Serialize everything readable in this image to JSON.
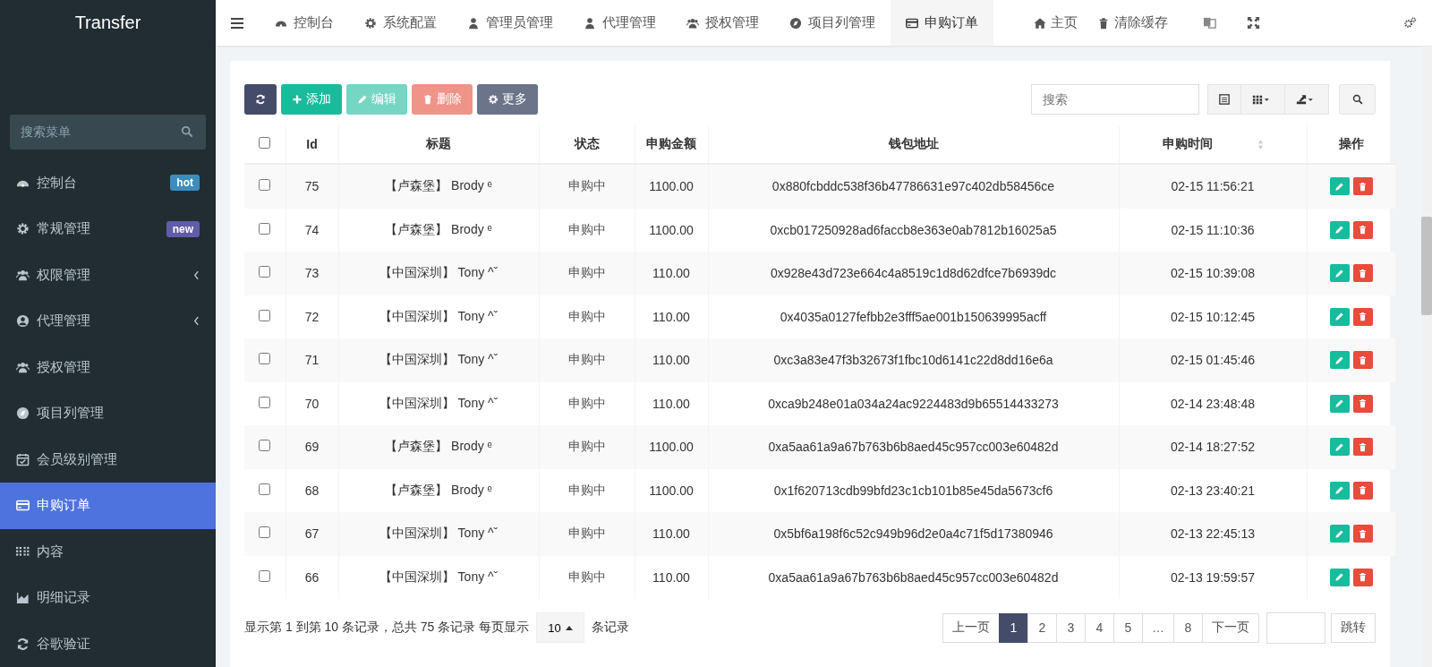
{
  "sidebar": {
    "logo": "Transfer",
    "search": {
      "placeholder": "搜索菜单"
    },
    "items": [
      {
        "label": "控制台",
        "badge": {
          "text": "hot",
          "color": "#3c8dbc"
        },
        "has_children": false,
        "selected": false
      },
      {
        "label": "常规管理",
        "badge": {
          "text": "new",
          "color": "#605ca8"
        },
        "has_children": false,
        "selected": false
      },
      {
        "label": "权限管理",
        "has_children": true,
        "selected": false
      },
      {
        "label": "代理管理",
        "has_children": true,
        "selected": false
      },
      {
        "label": "授权管理",
        "has_children": false,
        "selected": false
      },
      {
        "label": "项目列管理",
        "has_children": false,
        "selected": false
      },
      {
        "label": "会员级别管理",
        "has_children": false,
        "selected": false
      },
      {
        "label": "申购订单",
        "has_children": false,
        "selected": true
      },
      {
        "label": "内容",
        "has_children": false,
        "selected": false
      },
      {
        "label": "明细记录",
        "has_children": false,
        "selected": false
      },
      {
        "label": "谷歌验证",
        "has_children": false,
        "selected": false
      }
    ]
  },
  "tabs": [
    {
      "label": "控制台",
      "selected": false
    },
    {
      "label": "系统配置",
      "selected": false
    },
    {
      "label": "管理员管理",
      "selected": false
    },
    {
      "label": "代理管理",
      "selected": false
    },
    {
      "label": "授权管理",
      "selected": false
    },
    {
      "label": "项目列管理",
      "selected": false
    },
    {
      "label": "申购订单",
      "selected": true
    }
  ],
  "top_links": [
    "主页",
    "清除缓存"
  ],
  "toolbar": {
    "buttons": [
      {
        "kind": "refresh",
        "disabled": false
      },
      {
        "kind": "add",
        "label": "添加",
        "disabled": false
      },
      {
        "kind": "edit",
        "label": "编辑",
        "disabled": true
      },
      {
        "kind": "delete",
        "label": "删除",
        "disabled": true
      },
      {
        "kind": "more",
        "label": "更多",
        "disabled": false
      }
    ],
    "search": {
      "placeholder": "搜索"
    }
  },
  "table": {
    "select_all_checked": false,
    "columns": [
      "Id",
      "标题",
      "状态",
      "申购金额",
      "钱包地址",
      "申购时间",
      "操作"
    ],
    "rows": [
      {
        "id": "75",
        "title": "【卢森堡】 Brody ᵉ",
        "status": "申购中",
        "amount": "1100.00",
        "wallet": "0x880fcbddc538f36b47786631e97c402db58456ce",
        "time": "02-15 11:56:21",
        "checked": false
      },
      {
        "id": "74",
        "title": "【卢森堡】 Brody ᵉ",
        "status": "申购中",
        "amount": "1100.00",
        "wallet": "0xcb017250928ad6faccb8e363e0ab7812b16025a5",
        "time": "02-15 11:10:36",
        "checked": false
      },
      {
        "id": "73",
        "title": "【中国深圳】 Tony ^ˇ",
        "status": "申购中",
        "amount": "110.00",
        "wallet": "0x928e43d723e664c4a8519c1d8d62dfce7b6939dc",
        "time": "02-15 10:39:08",
        "checked": false
      },
      {
        "id": "72",
        "title": "【中国深圳】 Tony ^ˇ",
        "status": "申购中",
        "amount": "110.00",
        "wallet": "0x4035a0127fefbb2e3fff5ae001b150639995acff",
        "time": "02-15 10:12:45",
        "checked": false
      },
      {
        "id": "71",
        "title": "【中国深圳】 Tony ^ˇ",
        "status": "申购中",
        "amount": "110.00",
        "wallet": "0xc3a83e47f3b32673f1fbc10d6141c22d8dd16e6a",
        "time": "02-15 01:45:46",
        "checked": false
      },
      {
        "id": "70",
        "title": "【中国深圳】 Tony ^ˇ",
        "status": "申购中",
        "amount": "110.00",
        "wallet": "0xca9b248e01a034a24ac9224483d9b65514433273",
        "time": "02-14 23:48:48",
        "checked": false
      },
      {
        "id": "69",
        "title": "【卢森堡】 Brody ᵉ",
        "status": "申购中",
        "amount": "1100.00",
        "wallet": "0xa5aa61a9a67b763b6b8aed45c957cc003e60482d",
        "time": "02-14 18:27:52",
        "checked": false
      },
      {
        "id": "68",
        "title": "【卢森堡】 Brody ᵉ",
        "status": "申购中",
        "amount": "1100.00",
        "wallet": "0x1f620713cdb99bfd23c1cb101b85e45da5673cf6",
        "time": "02-13 23:40:21",
        "checked": false
      },
      {
        "id": "67",
        "title": "【中国深圳】 Tony ^ˇ",
        "status": "申购中",
        "amount": "110.00",
        "wallet": "0x5bf6a198f6c52c949b96d2e0a4c71f5d17380946",
        "time": "02-13 22:45:13",
        "checked": false
      },
      {
        "id": "66",
        "title": "【中国深圳】 Tony ^ˇ",
        "status": "申购中",
        "amount": "110.00",
        "wallet": "0xa5aa61a9a67b763b6b8aed45c957cc003e60482d",
        "time": "02-13 19:59:57",
        "checked": false
      }
    ]
  },
  "footer": {
    "summary": "显示第 1 到第 10 条记录，总共 75 条记录 每页显示",
    "page_size": "10",
    "summary_end": "条记录",
    "pages": [
      {
        "label": "上一页",
        "selected": false
      },
      {
        "label": "1",
        "selected": true
      },
      {
        "label": "2",
        "selected": false
      },
      {
        "label": "3",
        "selected": false
      },
      {
        "label": "4",
        "selected": false
      },
      {
        "label": "5",
        "selected": false
      },
      {
        "label": "…",
        "selected": false
      },
      {
        "label": "8",
        "selected": false
      },
      {
        "label": "下一页",
        "selected": false
      }
    ],
    "jump": "跳转"
  }
}
